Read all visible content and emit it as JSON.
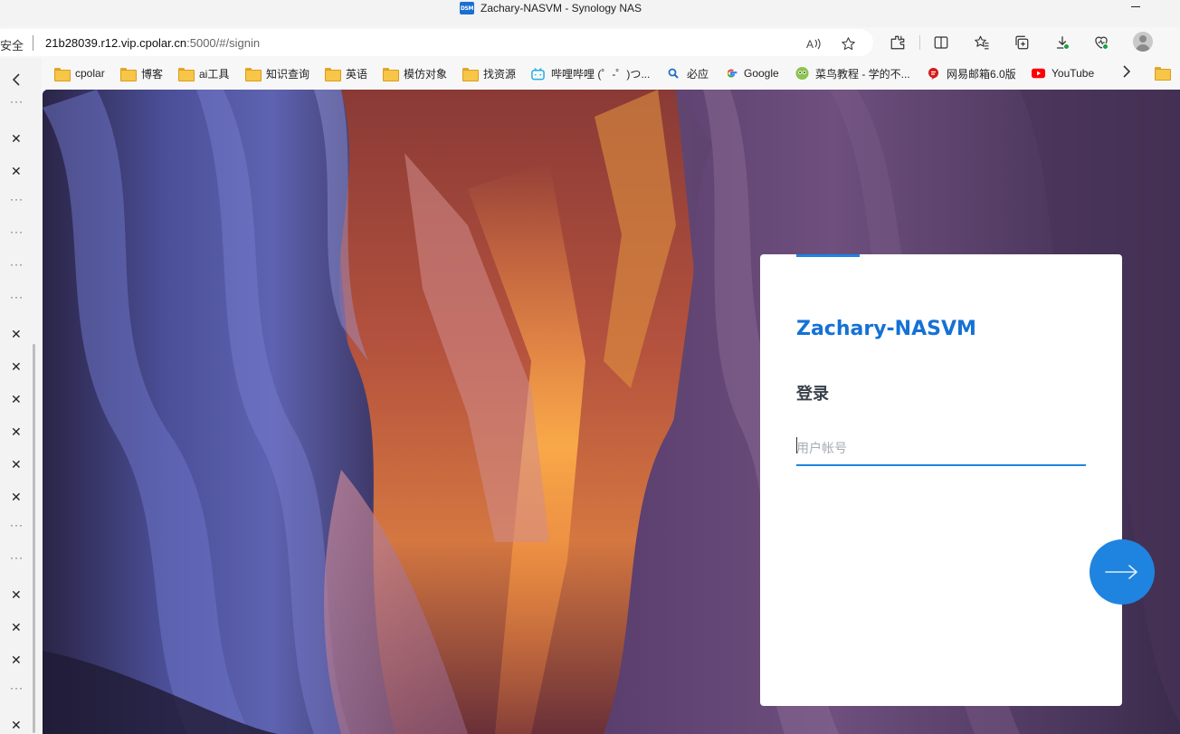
{
  "window": {
    "title": "Zachary-NASVM - Synology NAS",
    "favicon_text": "DSM"
  },
  "address_bar": {
    "security_text": "安全",
    "url_host": "21b28039.r12.vip.cpolar.cn",
    "url_rest": ":5000/#/signin"
  },
  "bookmarks": [
    {
      "label": "cpolar",
      "icon": "folder-icon"
    },
    {
      "label": "博客",
      "icon": "folder-icon"
    },
    {
      "label": "ai工具",
      "icon": "folder-icon"
    },
    {
      "label": "知识查询",
      "icon": "folder-icon"
    },
    {
      "label": "英语",
      "icon": "folder-icon"
    },
    {
      "label": "模仿对象",
      "icon": "folder-icon"
    },
    {
      "label": "找资源",
      "icon": "folder-icon"
    },
    {
      "label": "哔哩哔哩 (゜-゜)つ...",
      "icon": "bilibili-icon"
    },
    {
      "label": "必应",
      "icon": "search-icon"
    },
    {
      "label": "Google",
      "icon": "google-icon"
    },
    {
      "label": "菜鸟教程 - 学的不...",
      "icon": "runoob-icon"
    },
    {
      "label": "网易邮箱6.0版",
      "icon": "netease-icon"
    },
    {
      "label": "YouTube",
      "icon": "youtube-icon"
    }
  ],
  "sidebar": {
    "rows": [
      "dots",
      "close",
      "close",
      "dots",
      "dots",
      "dots",
      "dots",
      "close",
      "close",
      "close",
      "close",
      "close",
      "close",
      "dots",
      "dots",
      "close",
      "close",
      "close",
      "dots",
      "close"
    ]
  },
  "login": {
    "server_name": "Zachary-NASVM",
    "heading": "登录",
    "username_placeholder": "用户帐号"
  },
  "colors": {
    "accent": "#1f84e0",
    "server_name": "#1571d6"
  }
}
